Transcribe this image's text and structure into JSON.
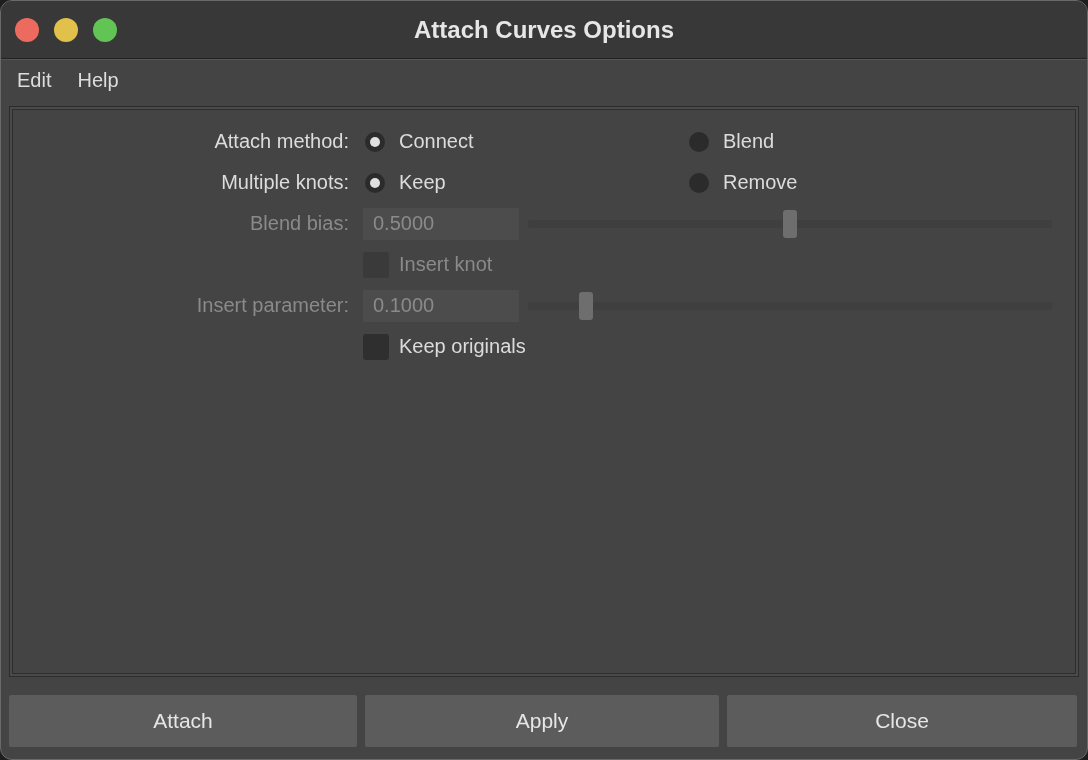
{
  "window": {
    "title": "Attach Curves Options"
  },
  "menu": [
    {
      "label": "Edit"
    },
    {
      "label": "Help"
    }
  ],
  "rows": [
    {
      "kind": "radio",
      "label": "Attach method:",
      "options": [
        {
          "label": "Connect",
          "selected": true
        },
        {
          "label": "Blend",
          "selected": false
        }
      ]
    },
    {
      "kind": "radio",
      "label": "Multiple knots:",
      "options": [
        {
          "label": "Keep",
          "selected": true
        },
        {
          "label": "Remove",
          "selected": false
        }
      ]
    },
    {
      "kind": "slider",
      "label": "Blend bias:",
      "value": "0.5000",
      "level": 0.5,
      "disabled": true
    },
    {
      "kind": "checkbox",
      "label": "Insert knot",
      "checked": false,
      "disabled": true
    },
    {
      "kind": "slider",
      "label": "Insert parameter:",
      "value": "0.1000",
      "level": 0.11,
      "disabled": true
    },
    {
      "kind": "checkbox",
      "label": "Keep originals",
      "checked": false,
      "disabled": false
    }
  ],
  "buttons": [
    {
      "label": "Attach"
    },
    {
      "label": "Apply"
    },
    {
      "label": "Close"
    }
  ]
}
